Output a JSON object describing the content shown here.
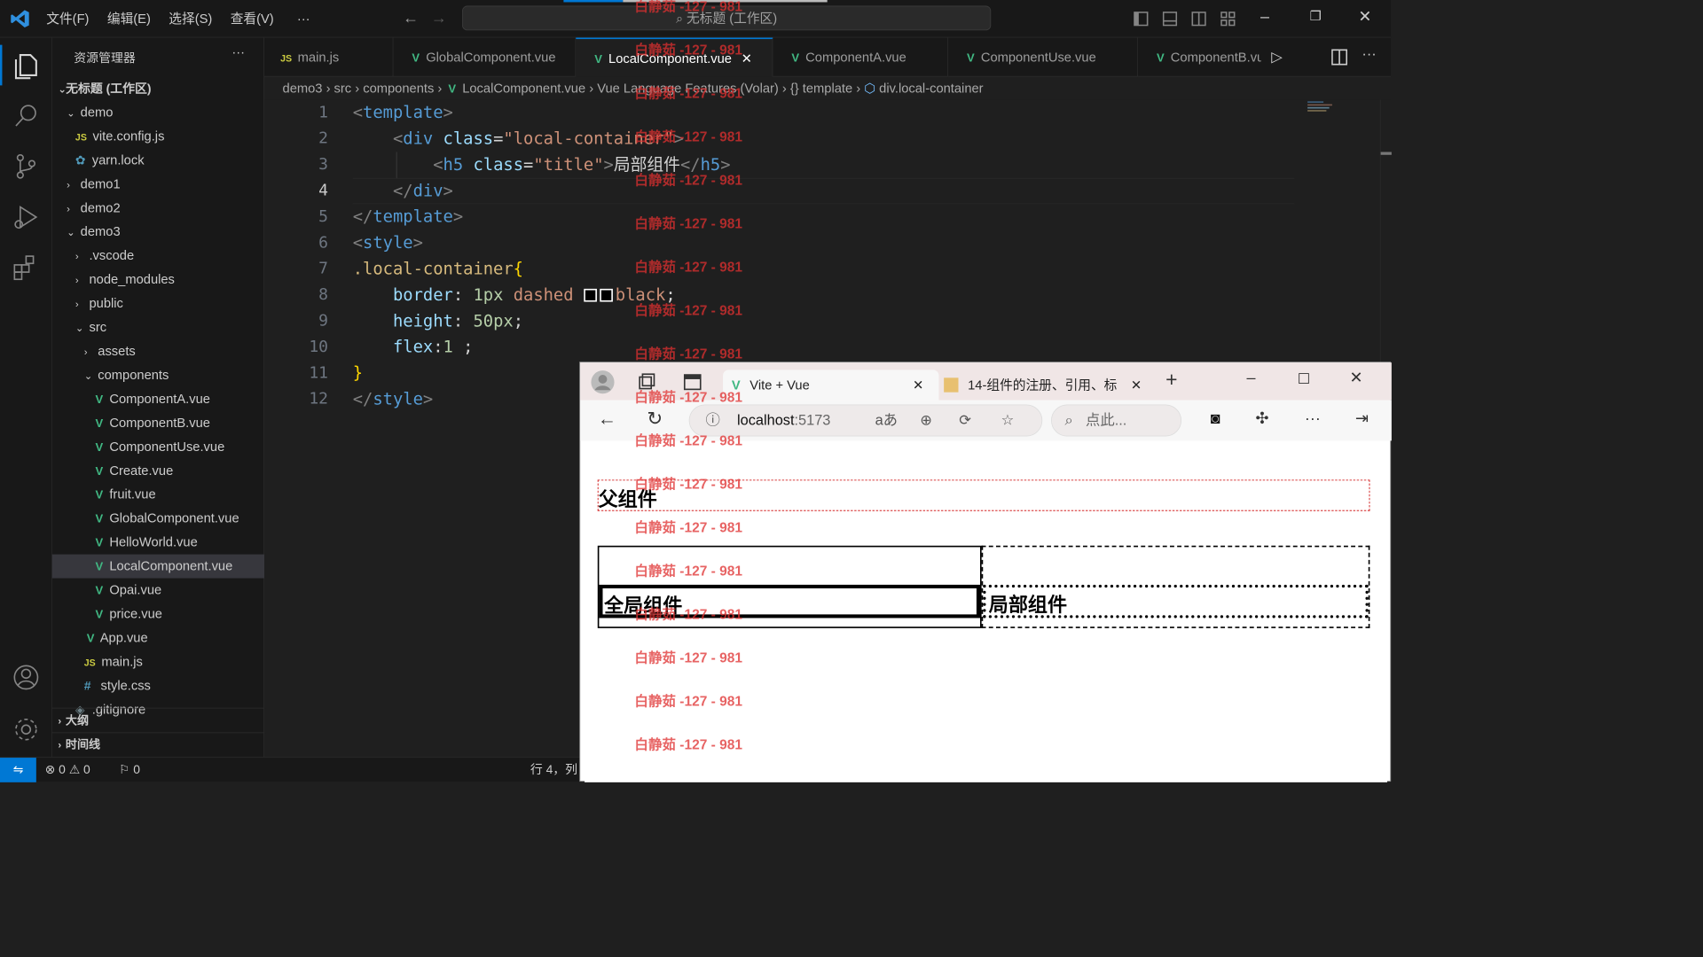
{
  "menu": [
    "文件(F)",
    "编辑(E)",
    "选择(S)",
    "查看(V)",
    "···"
  ],
  "search": {
    "label": "无标题 (工作区)"
  },
  "sidebar": {
    "title": "资源管理器",
    "more": "···",
    "workspace": "无标题 (工作区)",
    "items": [
      {
        "label": "demo",
        "type": "folder-open"
      },
      {
        "label": "vite.config.js",
        "type": "js"
      },
      {
        "label": "yarn.lock",
        "type": "yarn"
      },
      {
        "label": "demo1",
        "type": "folder"
      },
      {
        "label": "demo2",
        "type": "folder"
      },
      {
        "label": "demo3",
        "type": "folder-open"
      },
      {
        "label": ".vscode",
        "type": "folder"
      },
      {
        "label": "node_modules",
        "type": "folder"
      },
      {
        "label": "public",
        "type": "folder"
      },
      {
        "label": "src",
        "type": "folder-open"
      },
      {
        "label": "assets",
        "type": "folder"
      },
      {
        "label": "components",
        "type": "folder-open"
      },
      {
        "label": "ComponentA.vue",
        "type": "vue"
      },
      {
        "label": "ComponentB.vue",
        "type": "vue"
      },
      {
        "label": "ComponentUse.vue",
        "type": "vue"
      },
      {
        "label": "Create.vue",
        "type": "vue"
      },
      {
        "label": "fruit.vue",
        "type": "vue"
      },
      {
        "label": "GlobalComponent.vue",
        "type": "vue"
      },
      {
        "label": "HelloWorld.vue",
        "type": "vue"
      },
      {
        "label": "LocalComponent.vue",
        "type": "vue",
        "selected": true
      },
      {
        "label": "Opai.vue",
        "type": "vue"
      },
      {
        "label": "price.vue",
        "type": "vue"
      },
      {
        "label": "App.vue",
        "type": "vue"
      },
      {
        "label": "main.js",
        "type": "js"
      },
      {
        "label": "style.css",
        "type": "css"
      },
      {
        "label": ".gitignore",
        "type": "git"
      }
    ],
    "outline": "大纲",
    "timeline": "时间线"
  },
  "tabs": [
    {
      "label": "main.js",
      "type": "js"
    },
    {
      "label": "GlobalComponent.vue",
      "type": "vue"
    },
    {
      "label": "LocalComponent.vue",
      "type": "vue",
      "active": true
    },
    {
      "label": "ComponentA.vue",
      "type": "vue"
    },
    {
      "label": "ComponentUse.vue",
      "type": "vue"
    },
    {
      "label": "ComponentB.vu",
      "type": "vue"
    }
  ],
  "breadcrumb": [
    "demo3",
    "src",
    "components",
    "LocalComponent.vue",
    "Vue Language Features (Volar)",
    "{} template",
    "div.local-container"
  ],
  "code": {
    "line_numbers": [
      "1",
      "2",
      "3",
      "4",
      "5",
      "6",
      "7",
      "8",
      "9",
      "10",
      "11",
      "12"
    ],
    "current_line": "4",
    "l1": [
      "<",
      "template",
      ">"
    ],
    "l2": [
      "<",
      "div",
      " class",
      "=",
      "\"local-container\"",
      ">"
    ],
    "l3": [
      "<",
      "h5",
      " class",
      "=",
      "\"title\"",
      ">",
      "局部组件",
      "</",
      "h5",
      ">"
    ],
    "l4": [
      "</",
      "div",
      ">"
    ],
    "l5": [
      "</",
      "template",
      ">"
    ],
    "l6": [
      "<",
      "style",
      ">"
    ],
    "l7": [
      ".local-container",
      "{"
    ],
    "l8": [
      "border",
      ": ",
      "1px",
      " dashed ",
      "black",
      ";"
    ],
    "l9": [
      "height",
      ": ",
      "50px",
      ";"
    ],
    "l10": [
      "flex",
      ":",
      "1",
      " ;"
    ],
    "l11": [
      "}"
    ],
    "l12": [
      "</",
      "style",
      ">"
    ]
  },
  "status": {
    "errors": "0",
    "warnings": "0",
    "ports": "0",
    "cursor": "行 4，列"
  },
  "browser": {
    "tab1": "Vite + Vue",
    "tab2": "14-组件的注册、引用、标",
    "url_host": "localhost",
    "url_port": ":5173",
    "search_placeholder": "点此...",
    "parent_heading": "父组件",
    "global_heading": "全局组件",
    "local_heading": "局部组件"
  },
  "watermark": "白静茹 -127 - 981",
  "colors": {
    "accent": "#0078d4",
    "vue_green": "#41b883",
    "watermark": "#e03030"
  }
}
